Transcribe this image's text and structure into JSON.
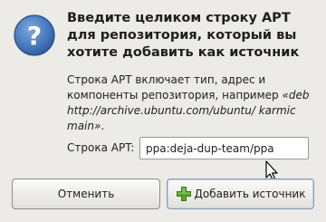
{
  "dialog": {
    "title": "Введите целиком строку APT для репозитория, который вы хотите добавить как источник",
    "description": {
      "text": "Строка APT включает тип, адрес и компоненты репозитория, например ",
      "example": "«deb http://archive.ubuntu.com/ubuntu/ karmic main»",
      "suffix": "."
    },
    "apt_line": {
      "label": "Строка APT:",
      "value": "ppa:deja-dup-team/ppa"
    },
    "buttons": {
      "cancel": "Отменить",
      "add": "Добавить источник"
    },
    "icons": {
      "question": "question-icon",
      "add": "plus-icon",
      "cursor": "cursor-icon"
    },
    "colors": {
      "question_icon": "#3a6bb0",
      "add_icon": "#58a232"
    }
  }
}
